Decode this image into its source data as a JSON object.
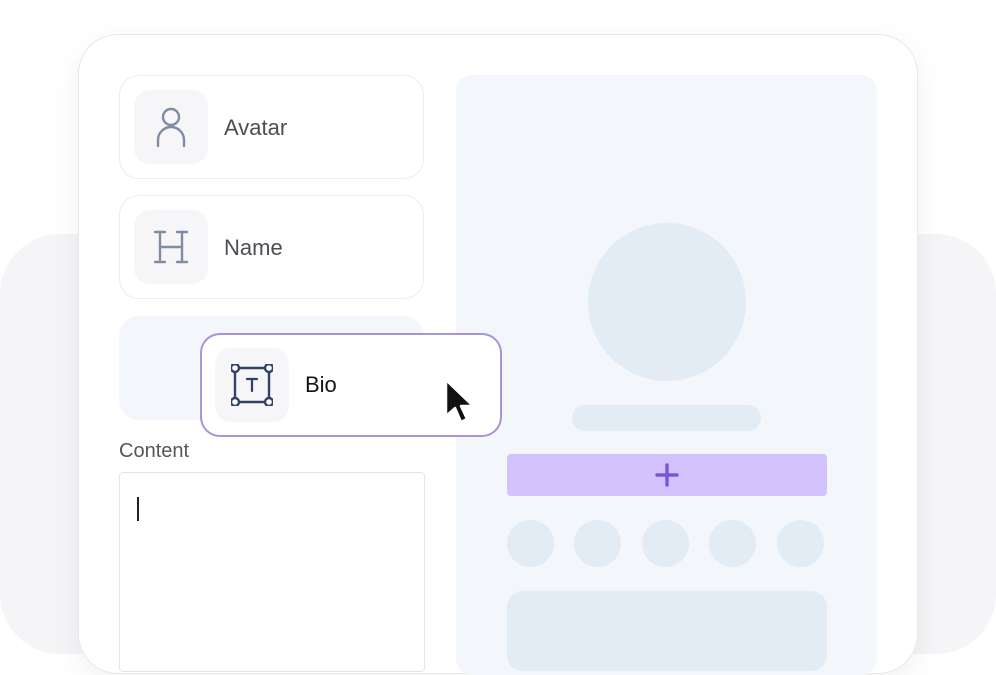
{
  "components": {
    "avatar": {
      "label": "Avatar",
      "icon": "person-icon"
    },
    "name": {
      "label": "Name",
      "icon": "heading-icon"
    },
    "bio": {
      "label": "Bio",
      "icon": "text-box-icon"
    }
  },
  "content": {
    "label": "Content",
    "value": ""
  },
  "preview": {
    "add_icon": "plus-icon",
    "social_placeholder_count": 5
  },
  "colors": {
    "accent": "#a993da",
    "add_bar": "#d3c2fb",
    "plus": "#7b55d9",
    "placeholder": "#e3ebf4",
    "icon": "#7f8ca3",
    "bio_icon": "#2f4266"
  }
}
